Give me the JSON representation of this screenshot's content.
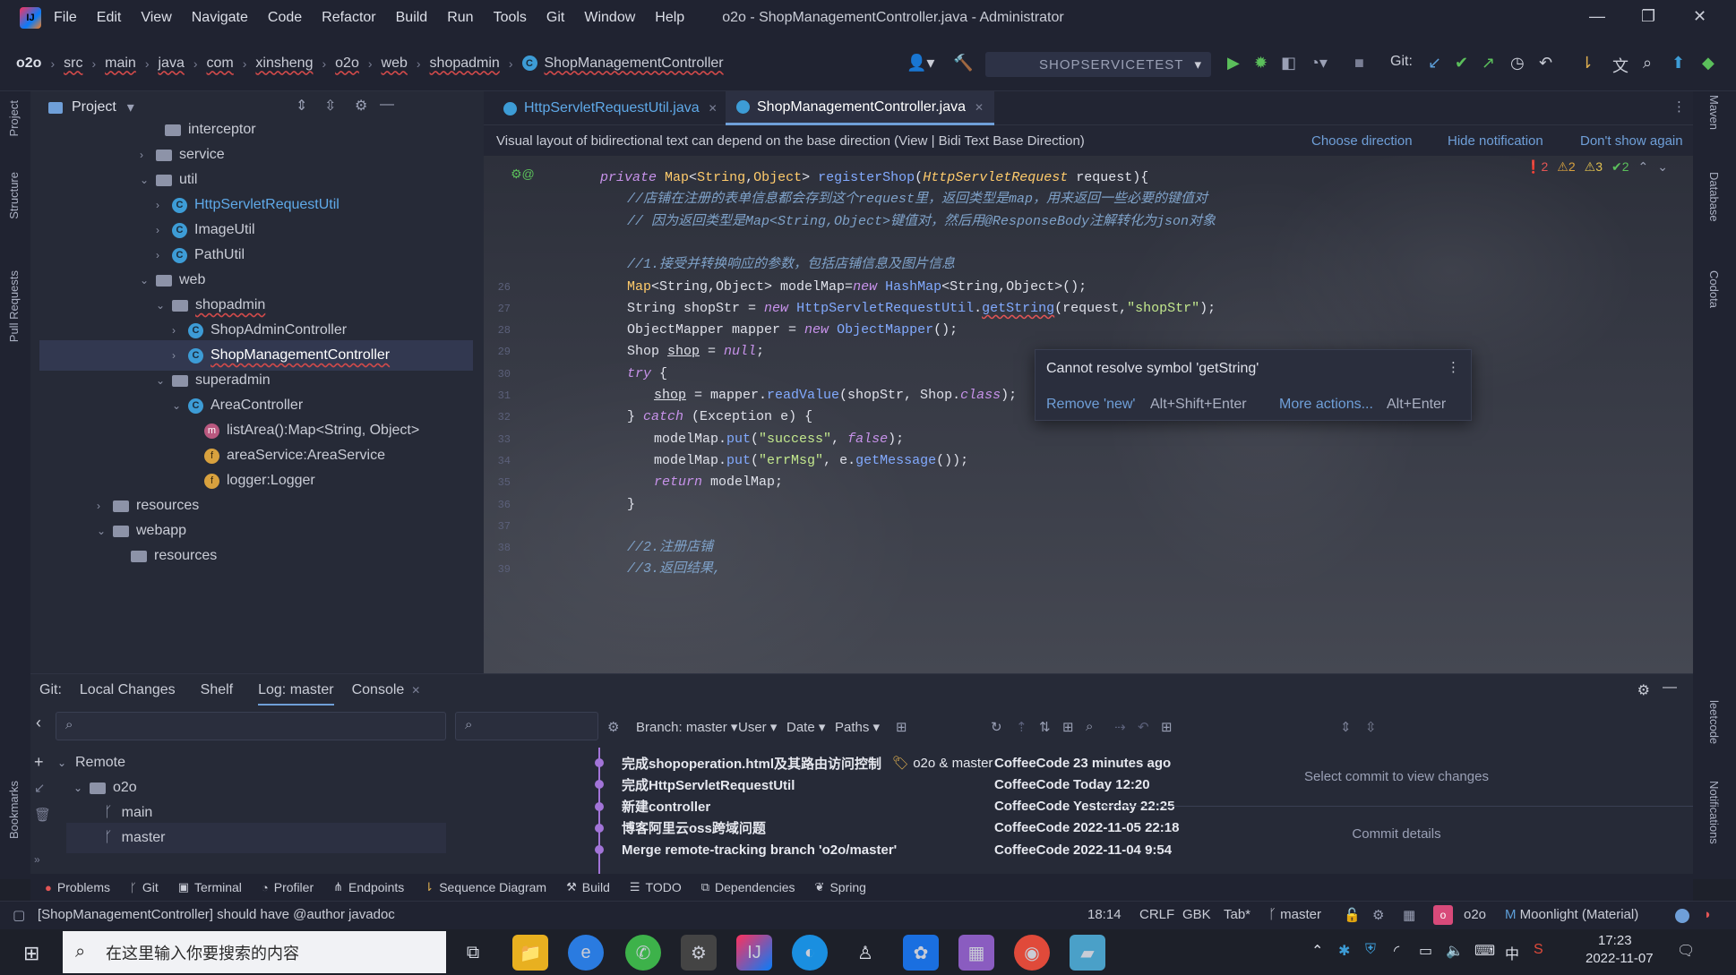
{
  "window": {
    "title": "o2o - ShopManagementController.java - Administrator",
    "menu": [
      "File",
      "Edit",
      "View",
      "Navigate",
      "Code",
      "Refactor",
      "Build",
      "Run",
      "Tools",
      "Git",
      "Window",
      "Help"
    ]
  },
  "breadcrumb": [
    "o2o",
    "src",
    "main",
    "java",
    "com",
    "xinsheng",
    "o2o",
    "web",
    "shopadmin",
    "ShopManagementController"
  ],
  "toolbar": {
    "run_config": "SHOPSERVICETEST",
    "git_label": "Git:"
  },
  "left_stripe": {
    "project": "Project",
    "structure": "Structure",
    "pull_requests": "Pull Requests",
    "bookmarks": "Bookmarks"
  },
  "project": {
    "header": "Project",
    "tree": [
      {
        "label": "interceptor",
        "kind": "folder"
      },
      {
        "label": "service",
        "kind": "folder"
      },
      {
        "label": "util",
        "kind": "folder"
      },
      {
        "label": "HttpServletRequestUtil",
        "kind": "class"
      },
      {
        "label": "ImageUtil",
        "kind": "class"
      },
      {
        "label": "PathUtil",
        "kind": "class"
      },
      {
        "label": "web",
        "kind": "folder"
      },
      {
        "label": "shopadmin",
        "kind": "folder"
      },
      {
        "label": "ShopAdminController",
        "kind": "class"
      },
      {
        "label": "ShopManagementController",
        "kind": "class"
      },
      {
        "label": "superadmin",
        "kind": "folder"
      },
      {
        "label": "AreaController",
        "kind": "class"
      },
      {
        "label": "listArea():Map<String, Object>",
        "kind": "method"
      },
      {
        "label": "areaService:AreaService",
        "kind": "field"
      },
      {
        "label": "logger:Logger",
        "kind": "field"
      },
      {
        "label": "resources",
        "kind": "folder"
      },
      {
        "label": "webapp",
        "kind": "folder"
      },
      {
        "label": "resources",
        "kind": "folder"
      }
    ]
  },
  "editor": {
    "tabs": [
      {
        "label": "HttpServletRequestUtil.java"
      },
      {
        "label": "ShopManagementController.java"
      }
    ],
    "notification": {
      "text": "Visual layout of bidirectional text can depend on the base direction (View | Bidi Text Base Direction)",
      "choose": "Choose direction",
      "hide": "Hide notification",
      "dont_show": "Don't show again"
    },
    "inspections": {
      "errors": "2",
      "warnings": "2",
      "weak": "3",
      "ok": "2"
    },
    "line_numbers": [
      "",
      "",
      "",
      "",
      "",
      "26",
      "27",
      "28",
      "29",
      "30",
      "31",
      "32",
      "33",
      "34",
      "35",
      "36",
      "37",
      "38",
      "39"
    ],
    "popup": {
      "message": "Cannot resolve symbol 'getString'",
      "action1": "Remove 'new'",
      "shortcut1": "Alt+Shift+Enter",
      "action2": "More actions...",
      "shortcut2": "Alt+Enter"
    }
  },
  "right_stripe": {
    "maven": "Maven",
    "database": "Database",
    "codota": "Codota",
    "leetcode": "leetcode",
    "notifications": "Notifications"
  },
  "git": {
    "tabs": [
      "Git:",
      "Local Changes",
      "Shelf",
      "Log: master",
      "Console"
    ],
    "filters": {
      "branch": "Branch: master",
      "user": "User",
      "date": "Date",
      "paths": "Paths"
    },
    "branches": {
      "remote": "Remote",
      "o2o": "o2o",
      "main": "main",
      "master": "master"
    },
    "commits": [
      {
        "message": "完成shopoperation.html及其路由访问控制",
        "refs": "o2o & master",
        "author": "CoffeeCode",
        "date": "23 minutes ago"
      },
      {
        "message": "完成HttpServletRequestUtil",
        "refs": "",
        "author": "CoffeeCode",
        "date": "Today 12:20"
      },
      {
        "message": "新建controller",
        "refs": "",
        "author": "CoffeeCode",
        "date": "Yesterday 22:25"
      },
      {
        "message": "博客阿里云oss跨域问题",
        "refs": "",
        "author": "CoffeeCode",
        "date": "2022-11-05 22:18"
      },
      {
        "message": "Merge remote-tracking branch 'o2o/master'",
        "refs": "",
        "author": "CoffeeCode",
        "date": "2022-11-04 9:54"
      }
    ],
    "details": {
      "select": "Select commit to view changes",
      "commit_details": "Commit details"
    }
  },
  "tool_windows": [
    "Problems",
    "Git",
    "Terminal",
    "Profiler",
    "Endpoints",
    "Sequence Diagram",
    "Build",
    "TODO",
    "Dependencies",
    "Spring"
  ],
  "status": {
    "message": "[ShopManagementController] should have @author javadoc",
    "position": "18:14",
    "line_sep": "CRLF",
    "encoding": "GBK",
    "indent": "Tab*",
    "branch": "master",
    "project": "o2o",
    "theme": "Moonlight (Material)"
  },
  "taskbar": {
    "search_placeholder": "在这里输入你要搜索的内容",
    "time": "17:23",
    "date": "2022-11-07",
    "ime": "中"
  },
  "colors": {
    "accent": "#6f9fd8",
    "error": "#e25555",
    "selection": "#323850"
  }
}
